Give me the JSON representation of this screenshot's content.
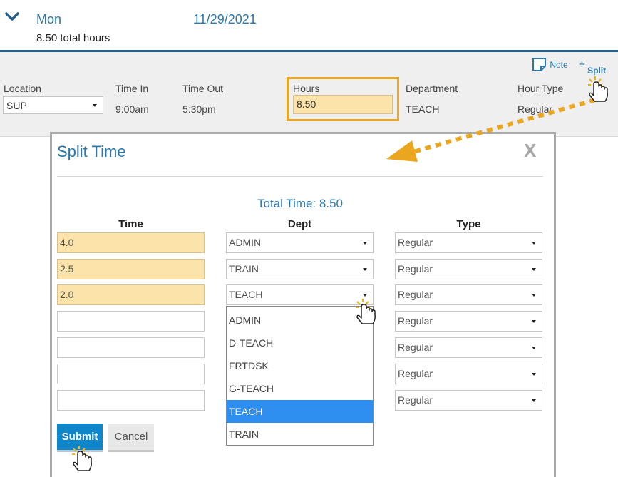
{
  "day": {
    "name": "Mon",
    "date": "11/29/2021",
    "total": "8.50 total hours"
  },
  "entry": {
    "location_label": "Location",
    "location_value": "SUP",
    "time_in_label": "Time In",
    "time_in_value": "9:00am",
    "time_out_label": "Time Out",
    "time_out_value": "5:30pm",
    "hours_label": "Hours",
    "hours_value": "8.50",
    "department_label": "Department",
    "department_value": "TEACH",
    "hour_type_label": "Hour Type",
    "hour_type_value": "Regular",
    "note_label": "Note",
    "split_label": "Split"
  },
  "dialog": {
    "title": "Split Time",
    "close_label": "X",
    "total_time": "Total Time: 8.50",
    "columns": {
      "time": "Time",
      "dept": "Dept",
      "type": "Type"
    },
    "rows": [
      {
        "time": "4.0",
        "dept": "ADMIN",
        "type": "Regular"
      },
      {
        "time": "2.5",
        "dept": "TRAIN",
        "type": "Regular"
      },
      {
        "time": "2.0",
        "dept": "TEACH",
        "type": "Regular"
      },
      {
        "time": "",
        "dept": "",
        "type": "Regular"
      },
      {
        "time": "",
        "dept": "",
        "type": "Regular"
      },
      {
        "time": "",
        "dept": "",
        "type": "Regular"
      },
      {
        "time": "",
        "dept": "",
        "type": "Regular"
      }
    ],
    "dept_options": [
      "ADMIN",
      "D-TEACH",
      "FRTDSK",
      "G-TEACH",
      "TEACH",
      "TRAIN"
    ],
    "dept_selected": "TEACH",
    "submit_label": "Submit",
    "cancel_label": "Cancel"
  },
  "colors": {
    "accent": "#2a78ae",
    "highlight": "#eaa61e",
    "input_fill": "#fbe3aa",
    "selected_option": "#2f8ff0",
    "submit": "#0e86c9"
  },
  "icons": [
    "chevron-down-icon",
    "note-icon",
    "split-icon",
    "close-icon",
    "hand-cursor-icon"
  ]
}
